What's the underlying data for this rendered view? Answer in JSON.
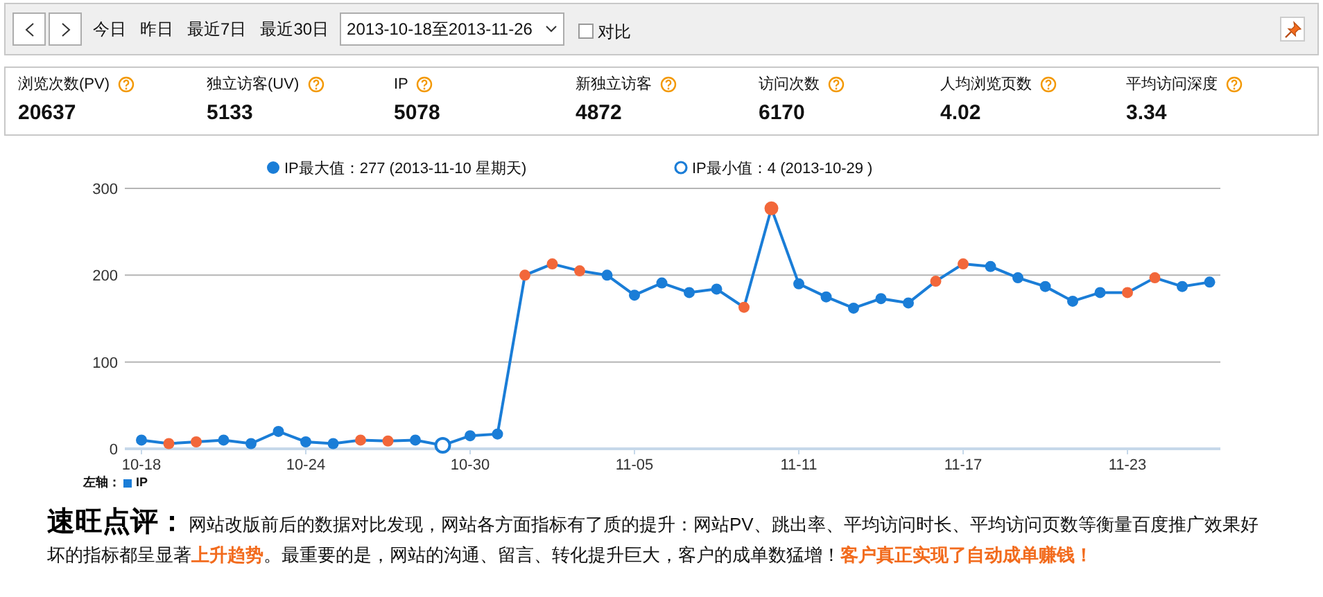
{
  "toolbar": {
    "quick_ranges": [
      {
        "label": "今日",
        "selected": false
      },
      {
        "label": "昨日",
        "selected": false
      },
      {
        "label": "最近7日",
        "selected": false
      },
      {
        "label": "最近30日",
        "selected": false
      }
    ],
    "date_range": "2013-10-18至2013-11-26",
    "compare": {
      "label": "对比",
      "checked": false
    }
  },
  "stats": [
    {
      "label": "浏览次数(PV)",
      "value": "20637"
    },
    {
      "label": "独立访客(UV)",
      "value": "5133"
    },
    {
      "label": "IP",
      "value": "5078"
    },
    {
      "label": "新独立访客",
      "value": "4872"
    },
    {
      "label": "访问次数",
      "value": "6170"
    },
    {
      "label": "人均浏览页数",
      "value": "4.02"
    },
    {
      "label": "平均访问深度",
      "value": "3.34"
    }
  ],
  "chart": {
    "legend": [
      {
        "kind": "max",
        "label": "IP最大值：277 (2013-11-10 星期天)"
      },
      {
        "kind": "min",
        "label": "IP最小值：4 (2013-10-29 )"
      }
    ],
    "axis_note": {
      "label": "左轴："
    },
    "markers": [
      {
        "color": "#1a7dd7"
      },
      {
        "color": "#f2673a"
      },
      {
        "color": "#f2673a"
      },
      {
        "color": "#1a7dd7"
      },
      {
        "color": "#1a7dd7"
      },
      {
        "color": "#1a7dd7"
      },
      {
        "color": "#1a7dd7"
      },
      {
        "color": "#1a7dd7"
      },
      {
        "color": "#f2673a"
      },
      {
        "color": "#f2673a"
      },
      {
        "color": "#1a7dd7"
      },
      {
        "color": "#1a7dd7"
      },
      {
        "color": "#1a7dd7"
      },
      {
        "color": "#1a7dd7"
      },
      {
        "color": "#f2673a"
      },
      {
        "color": "#f2673a"
      },
      {
        "color": "#f2673a"
      },
      {
        "color": "#1a7dd7"
      },
      {
        "color": "#1a7dd7"
      },
      {
        "color": "#1a7dd7"
      },
      {
        "color": "#1a7dd7"
      },
      {
        "color": "#1a7dd7"
      },
      {
        "color": "#f2673a"
      },
      {
        "color": "#f2673a"
      },
      {
        "color": "#1a7dd7"
      },
      {
        "color": "#1a7dd7"
      },
      {
        "color": "#1a7dd7"
      },
      {
        "color": "#1a7dd7"
      },
      {
        "color": "#1a7dd7"
      },
      {
        "color": "#f2673a"
      },
      {
        "color": "#f2673a"
      },
      {
        "color": "#1a7dd7"
      },
      {
        "color": "#1a7dd7"
      },
      {
        "color": "#1a7dd7"
      },
      {
        "color": "#1a7dd7"
      },
      {
        "color": "#1a7dd7"
      },
      {
        "color": "#f2673a"
      },
      {
        "color": "#f2673a"
      },
      {
        "color": "#1a7dd7"
      },
      {
        "color": "#1a7dd7"
      }
    ],
    "chart_data": {
      "type": "line",
      "categories": [
        "10-18",
        null,
        null,
        null,
        null,
        null,
        "10-24",
        null,
        null,
        null,
        null,
        null,
        "10-30",
        null,
        null,
        null,
        null,
        null,
        "11-05",
        null,
        null,
        null,
        null,
        null,
        "11-11",
        null,
        null,
        null,
        null,
        null,
        "11-17",
        null,
        null,
        null,
        null,
        null,
        "11-23",
        null,
        null,
        null
      ],
      "series": [
        {
          "name": "IP",
          "color": "#1a7dd7",
          "marker": "circle",
          "values": [
            10,
            6,
            8,
            10,
            6,
            20,
            8,
            6,
            10,
            9,
            10,
            4,
            15,
            17,
            200,
            213,
            205,
            200,
            177,
            191,
            180,
            184,
            163,
            277,
            190,
            175,
            162,
            173,
            168,
            193,
            213,
            210,
            197,
            187,
            170,
            180,
            180,
            197,
            187,
            192
          ]
        }
      ],
      "ylim": [
        0,
        300
      ],
      "yticks": [
        0,
        100,
        200,
        300
      ]
    }
  },
  "review": {
    "title": "速旺点评：",
    "segments": [
      {
        "kind": "plain",
        "text": "网站改版前后的数据对比发现，网站各方面指标有了质的提升：网站PV、跳出率、平均访问时长、平均访问页数等衡量百度推广效果好坏的指标都呈显著"
      },
      {
        "kind": "highlight",
        "text": "上升趋势"
      },
      {
        "kind": "plain",
        "text": "。最重要的是，网站的沟通、留言、转化提升巨大，客户的成单数猛增！"
      },
      {
        "kind": "highlight",
        "text": "客户真正实现了自动成单赚钱！"
      }
    ]
  }
}
